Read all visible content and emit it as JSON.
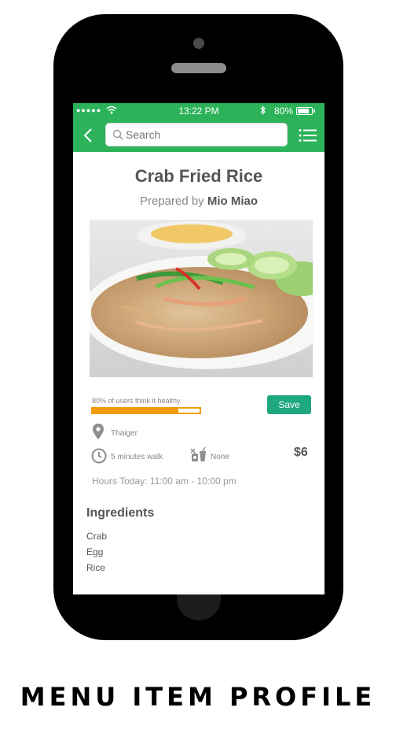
{
  "status_bar": {
    "signal": "●●●●●",
    "time": "13:22 PM",
    "battery": "80%",
    "battery_level": 0.8
  },
  "nav": {
    "back_icon": "chevron-left-icon",
    "search_placeholder": "Search",
    "menu_icon": "list-icon"
  },
  "item": {
    "name": "Crab Fried Rice",
    "prepared_prefix": "Prepared by",
    "chef": "Mio Miao",
    "photo": "crab-fried-rice-photo"
  },
  "health": {
    "label": "80% of users think it healthy",
    "fraction": 0.8
  },
  "save_label": "Save",
  "details": {
    "location": "Thaiger",
    "walk": "5 minutes walk",
    "dietary": "None",
    "price": "$6",
    "hours": "Hours Today: 11:00 am - 10:00 pm"
  },
  "ingredients": {
    "title": "Ingredients",
    "items": [
      "Crab",
      "Egg",
      "Rice"
    ]
  },
  "caption": "MENU ITEM PROFILE",
  "colors": {
    "accent_green": "#2cb35a",
    "button_teal": "#1fa87f",
    "health_orange": "#f29b0c"
  }
}
